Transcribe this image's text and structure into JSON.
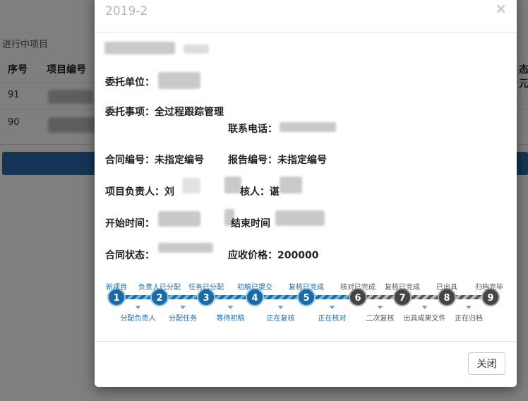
{
  "background": {
    "section_title": "进行中项目",
    "columns": [
      "序号",
      "项目编号"
    ],
    "right_header_fragment": "态/元",
    "rows": [
      {
        "index": "91"
      },
      {
        "index": "90"
      }
    ]
  },
  "modal": {
    "title": "2019-2",
    "close_symbol": "×",
    "fields": {
      "client_label": "委托单位：",
      "matter_label": "委托事项：",
      "matter_value": "全过程跟踪管理",
      "phone_label": "联系电话：",
      "contract_no_label": "合同编号：",
      "contract_no_value": "未指定编号",
      "report_no_label": "报告编号：",
      "report_no_value": "未指定编号",
      "leader_label": "项目负责人：",
      "leader_value": "刘",
      "reviewer_label": "核人：",
      "reviewer_value": "谌",
      "start_label": "开始时间：",
      "end_label": "结束时间",
      "status_label": "合同状态：",
      "price_label": "应收价格：",
      "price_value": "200000"
    },
    "progress": {
      "completed_color": "#1a6aa6",
      "pending_color": "#555555",
      "steps": [
        {
          "num": "1",
          "label": "新项目",
          "done": true
        },
        {
          "num": "2",
          "label": "负责人已分配",
          "done": true
        },
        {
          "num": "3",
          "label": "任务已分配",
          "done": true
        },
        {
          "num": "4",
          "label": "初稿已提交",
          "done": true
        },
        {
          "num": "5",
          "label": "复核已完成",
          "done": true
        },
        {
          "num": "6",
          "label": "核对已完成",
          "done": false
        },
        {
          "num": "7",
          "label": "复核已完成",
          "done": false
        },
        {
          "num": "8",
          "label": "已出具",
          "done": false
        },
        {
          "num": "9",
          "label": "归档完毕",
          "done": false
        }
      ],
      "transitions": [
        {
          "label": "分配负责人",
          "done": true
        },
        {
          "label": "分配任务",
          "done": true
        },
        {
          "label": "等待初稿",
          "done": true
        },
        {
          "label": "正在复核",
          "done": true
        },
        {
          "label": "正在核对",
          "done": true
        },
        {
          "label": "二次复核",
          "done": false
        },
        {
          "label": "出具成果文件",
          "done": false
        },
        {
          "label": "正在归档",
          "done": false
        }
      ]
    },
    "footer": {
      "close_button": "关闭"
    }
  }
}
